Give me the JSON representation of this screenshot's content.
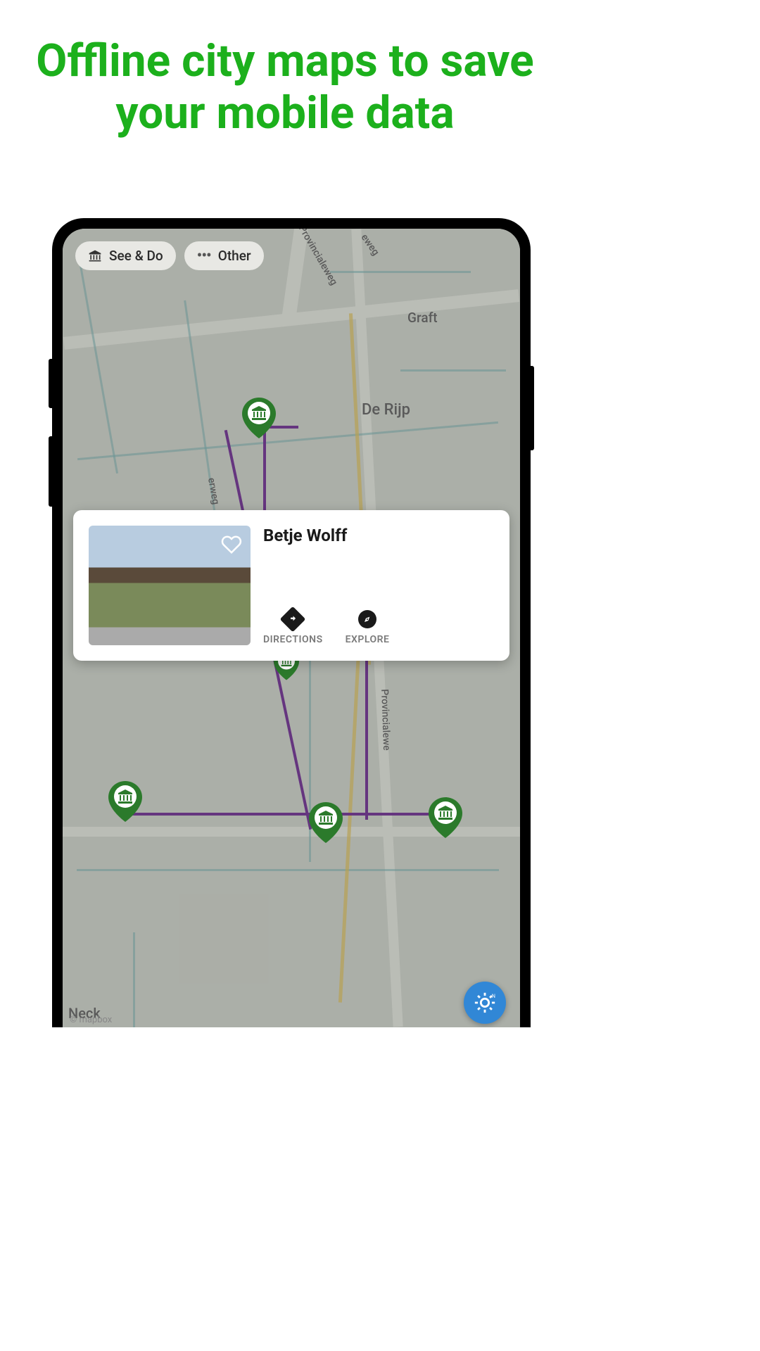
{
  "headline": "Offline city maps to save your mobile data",
  "chips": {
    "see_do": "See & Do",
    "other": "Other"
  },
  "map_labels": {
    "graft": "Graft",
    "de_rijp": "De Rijp",
    "provincialeweg": "Provincialeweg",
    "provincialewe": "Provincialewe",
    "erweg": "erweg",
    "eweg": "eweg",
    "neck": "Neck"
  },
  "info_card": {
    "title": "Betje Wolff",
    "directions_label": "DIRECTIONS",
    "explore_label": "EXPLORE"
  },
  "attribution": "© mapbox",
  "colors": {
    "accent": "#1cb01c",
    "pin": "#2b7a2b"
  }
}
